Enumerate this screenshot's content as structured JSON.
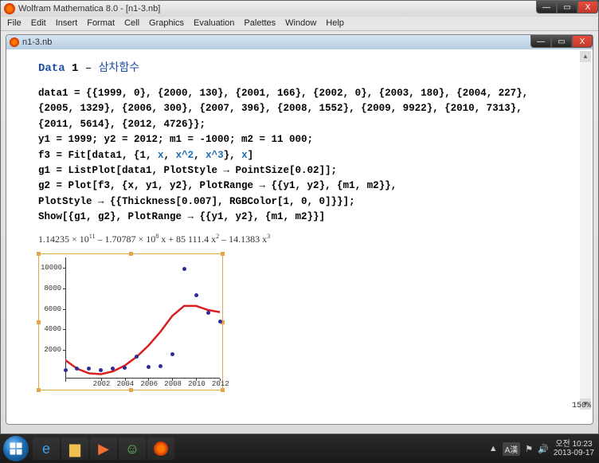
{
  "outer_window": {
    "title": "Wolfram Mathematica 8.0 - [n1-3.nb]"
  },
  "menu": {
    "items": [
      "File",
      "Edit",
      "Insert",
      "Format",
      "Cell",
      "Graphics",
      "Evaluation",
      "Palettes",
      "Window",
      "Help"
    ]
  },
  "inner_window": {
    "title": "n1-3.nb"
  },
  "section": {
    "kw": "Data",
    "num": "1",
    "dash": " – ",
    "korean": "삼차함수"
  },
  "code": {
    "l1": "data1 = {{1999, 0}, {2000, 130}, {2001, 166}, {2002, 0}, {2003, 180}, {2004, 227},",
    "l2": "    {2005, 1329}, {2006, 300}, {2007, 396}, {2008, 1552}, {2009, 9922}, {2010, 7313},",
    "l3": "    {2011, 5614}, {2012, 4726}};",
    "l4a": "y1 = 1999; y2 = 2012; m1 = -1000; m2 = 11 000;",
    "l5a": "f3 = Fit[data1, {1, ",
    "l5b": "x",
    "l5c": ", ",
    "l5d": "x^2",
    "l5e": ", ",
    "l5f": "x^3",
    "l5g": "}, ",
    "l5h": "x",
    "l5i": "]",
    "l6": "g1 = ListPlot[data1, PlotStyle → PointSize[0.02]];",
    "l7": "g2 = Plot[f3, {x, y1, y2}, PlotRange → {{y1, y2}, {m1, m2}},",
    "l8": "    PlotStyle → {{Thickness[0.007], RGBColor[1, 0, 0]}}];",
    "l9": "Show[{g1, g2}, PlotRange → {{y1, y2}, {m1, m2}}]"
  },
  "output": {
    "text_parts": [
      "1.14235 × 10",
      "11",
      " – 1.70787 × 10",
      "8",
      " x + 85 111.4 x",
      "2",
      " – 14.1383 x",
      "3"
    ]
  },
  "chart_data": {
    "type": "scatter+line",
    "title": "",
    "xlabel": "",
    "ylabel": "",
    "xlim": [
      1999,
      2012
    ],
    "ylim": [
      -1000,
      11000
    ],
    "x_ticks": [
      2002,
      2004,
      2006,
      2008,
      2010,
      2012
    ],
    "y_ticks": [
      2000,
      4000,
      6000,
      8000,
      10000
    ],
    "points": [
      {
        "x": 1999,
        "y": 0
      },
      {
        "x": 2000,
        "y": 130
      },
      {
        "x": 2001,
        "y": 166
      },
      {
        "x": 2002,
        "y": 0
      },
      {
        "x": 2003,
        "y": 180
      },
      {
        "x": 2004,
        "y": 227
      },
      {
        "x": 2005,
        "y": 1329
      },
      {
        "x": 2006,
        "y": 300
      },
      {
        "x": 2007,
        "y": 396
      },
      {
        "x": 2008,
        "y": 1552
      },
      {
        "x": 2009,
        "y": 9922
      },
      {
        "x": 2010,
        "y": 7313
      },
      {
        "x": 2011,
        "y": 5614
      },
      {
        "x": 2012,
        "y": 4726
      }
    ],
    "curve": {
      "color": "#d82020",
      "samples_x": [
        1999,
        2000,
        2001,
        2002,
        2003,
        2004,
        2005,
        2006,
        2007,
        2008,
        2009,
        2010,
        2011,
        2012
      ],
      "samples_y": [
        802,
        -42,
        -490,
        -570,
        -310,
        262,
        1119,
        2233,
        3576,
        5121,
        6100,
        6100,
        5700,
        5500
      ]
    }
  },
  "zoom": "150%",
  "taskbar": {
    "clock_line1": "오전 10:23",
    "clock_line2": "2013-09-17",
    "lang": "A漢"
  }
}
